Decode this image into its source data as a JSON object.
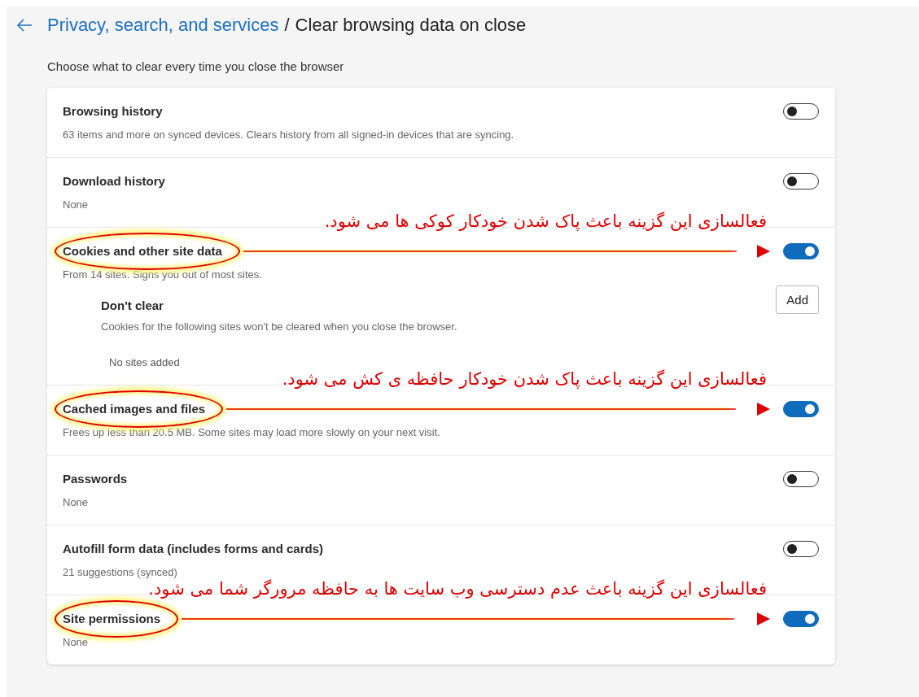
{
  "header": {
    "link": "Privacy, search, and services",
    "separator": "/",
    "title": "Clear browsing data on close"
  },
  "subtitle": "Choose what to clear every time you close the browser",
  "rows": [
    {
      "title": "Browsing history",
      "description": "63 items and more on synced devices. Clears history from all signed-in devices that are syncing.",
      "on": false
    },
    {
      "title": "Download history",
      "description": "None",
      "on": false
    },
    {
      "title": "Cookies and other site data",
      "description": "From 14 sites. Signs you out of most sites.",
      "on": true,
      "annotation": "فعالسازی این گزینه باعث پاک شدن خودکار کوکی ها می شود.",
      "sub": {
        "title": "Don't clear",
        "description": "Cookies for the following sites won't be cleared when you close the browser.",
        "button": "Add",
        "empty": "No sites added"
      }
    },
    {
      "title": "Cached images and files",
      "description": "Frees up less than 20.5 MB. Some sites may load more slowly on your next visit.",
      "on": true,
      "annotation": "فعالسازی این گزینه باعث پاک شدن خودکار حافظه ی کش می شود."
    },
    {
      "title": "Passwords",
      "description": "None",
      "on": false
    },
    {
      "title": "Autofill form data (includes forms and cards)",
      "description": "21 suggestions (synced)",
      "on": false
    },
    {
      "title": "Site permissions",
      "description": "None",
      "on": true,
      "annotation": "فعالسازی این گزینه باعث عدم دسترسی وب سایت ها به حافظه مرورگر شما می شود."
    }
  ]
}
